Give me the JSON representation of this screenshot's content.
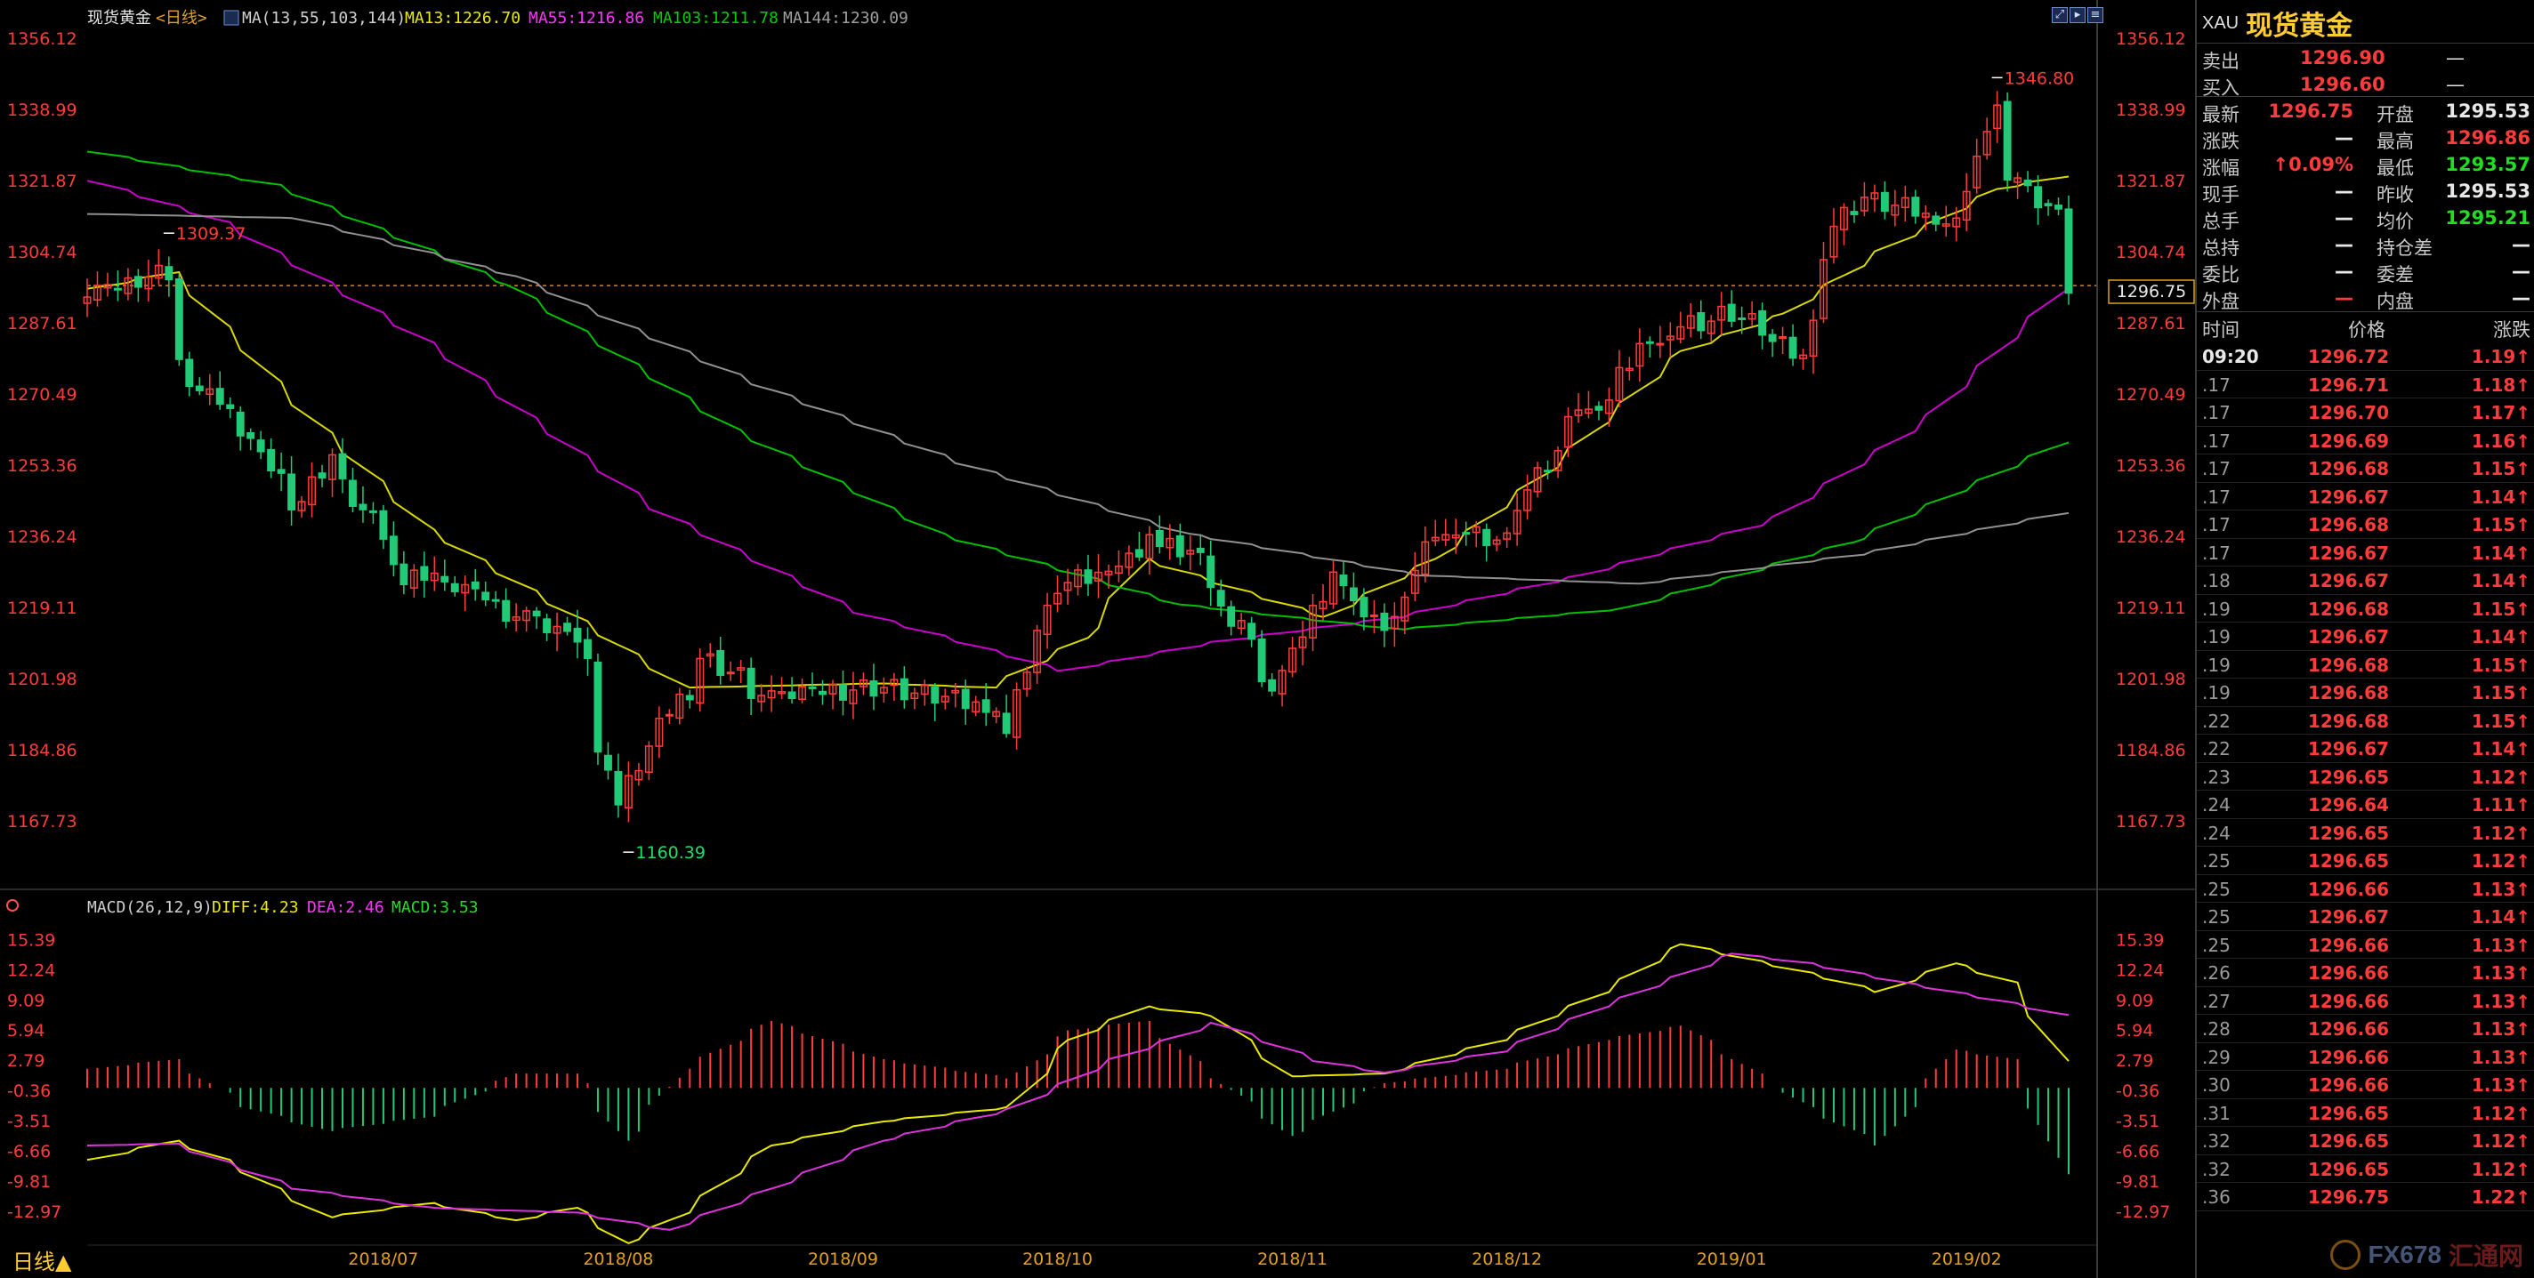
{
  "header": {
    "symbol_name": "现货黄金",
    "period": "<日线>",
    "ma_label": "MA(13,55,103,144)",
    "ma13_label": "MA13:1226.70",
    "ma55_label": "MA55:1216.86",
    "ma103_label": "MA103:1211.78",
    "ma144_label": "MA144:1230.09"
  },
  "macd_header": {
    "label": "MACD(26,12,9)",
    "diff_label": "DIFF:4.23",
    "dea_label": "DEA:2.46",
    "macd_label": "MACD:3.53"
  },
  "bottom_bar": {
    "period_label": "日线▲"
  },
  "current_price_tag": "1296.75",
  "colors": {
    "up": "#ff3b3b",
    "down": "#22c977",
    "ma13": "#d8d800",
    "ma55": "#cc00cc",
    "ma103": "#00c000",
    "ma144": "#909090",
    "diff": "#e8e800",
    "dea": "#dd33dd"
  },
  "chart_data": [
    {
      "type": "candlestick",
      "title": "现货黄金<日线>",
      "ylim": [
        1160,
        1358
      ],
      "y_ticks": [
        "1356.12",
        "1338.99",
        "1321.87",
        "1304.74",
        "1287.61",
        "1270.49",
        "1253.36",
        "1236.24",
        "1219.11",
        "1201.98",
        "1184.86",
        "1167.73"
      ],
      "x_ticks": [
        "2018/07",
        "2018/08",
        "2018/09",
        "2018/10",
        "2018/11",
        "2018/12",
        "2019/01",
        "2019/02"
      ],
      "annotations": [
        {
          "text": "1309.37",
          "date": "2018-06-14",
          "value": 1309.37
        },
        {
          "text": "1160.39",
          "date": "2018-08-16",
          "value": 1160.39
        },
        {
          "text": "1346.80",
          "date": "2019-02-20",
          "value": 1346.8
        }
      ],
      "anchors": [
        [
          "2018-06-04",
          1294
        ],
        [
          "2018-06-14",
          1300
        ],
        [
          "2018-06-15",
          1279
        ],
        [
          "2018-06-22",
          1269
        ],
        [
          "2018-07-02",
          1241
        ],
        [
          "2018-07-06",
          1256
        ],
        [
          "2018-07-17",
          1227
        ],
        [
          "2018-07-26",
          1222
        ],
        [
          "2018-08-01",
          1217
        ],
        [
          "2018-08-09",
          1211
        ],
        [
          "2018-08-15",
          1174
        ],
        [
          "2018-08-17",
          1180
        ],
        [
          "2018-08-27",
          1207
        ],
        [
          "2018-09-05",
          1197
        ],
        [
          "2018-09-20",
          1200
        ],
        [
          "2018-10-05",
          1196
        ],
        [
          "2018-10-08",
          1189
        ],
        [
          "2018-10-12",
          1222
        ],
        [
          "2018-10-23",
          1231
        ],
        [
          "2018-10-26",
          1235
        ],
        [
          "2018-11-01",
          1233
        ],
        [
          "2018-11-13",
          1201
        ],
        [
          "2018-11-21",
          1226
        ],
        [
          "2018-11-28",
          1216
        ],
        [
          "2018-12-06",
          1239
        ],
        [
          "2018-12-14",
          1235
        ],
        [
          "2018-12-21",
          1257
        ],
        [
          "2019-01-04",
          1285
        ],
        [
          "2019-01-15",
          1290
        ],
        [
          "2019-01-24",
          1280
        ],
        [
          "2019-01-29",
          1311
        ],
        [
          "2019-02-01",
          1318
        ],
        [
          "2019-02-14",
          1313
        ],
        [
          "2019-02-20",
          1338
        ],
        [
          "2019-02-21",
          1324
        ],
        [
          "2019-02-27",
          1316
        ],
        [
          "2019-02-28",
          1313
        ],
        [
          "2019-03-01",
          1296.75
        ]
      ],
      "ma_lines": {
        "MA13": [
          [
            "2018-06-04",
            1296
          ],
          [
            "2018-06-15",
            1300
          ],
          [
            "2018-07-02",
            1268
          ],
          [
            "2018-07-20",
            1238
          ],
          [
            "2018-08-10",
            1216
          ],
          [
            "2018-08-24",
            1200
          ],
          [
            "2018-09-20",
            1201
          ],
          [
            "2018-10-05",
            1200
          ],
          [
            "2018-10-18",
            1212
          ],
          [
            "2018-10-26",
            1231
          ],
          [
            "2018-11-09",
            1223
          ],
          [
            "2018-11-20",
            1217
          ],
          [
            "2018-12-05",
            1231
          ],
          [
            "2018-12-21",
            1253
          ],
          [
            "2019-01-08",
            1281
          ],
          [
            "2019-01-22",
            1290
          ],
          [
            "2019-02-04",
            1305
          ],
          [
            "2019-02-20",
            1320
          ],
          [
            "2019-03-01",
            1323
          ]
        ],
        "MA55": [
          [
            "2018-06-04",
            1322
          ],
          [
            "2018-06-22",
            1312
          ],
          [
            "2018-07-20",
            1283
          ],
          [
            "2018-08-20",
            1243
          ],
          [
            "2018-09-17",
            1218
          ],
          [
            "2018-10-15",
            1204
          ],
          [
            "2018-11-05",
            1211
          ],
          [
            "2018-11-30",
            1217
          ],
          [
            "2018-12-25",
            1227
          ],
          [
            "2019-01-20",
            1240
          ],
          [
            "2019-02-10",
            1264
          ],
          [
            "2019-03-01",
            1296
          ]
        ],
        "MA103": [
          [
            "2018-06-04",
            1329
          ],
          [
            "2018-06-29",
            1321
          ],
          [
            "2018-07-31",
            1297
          ],
          [
            "2018-08-31",
            1262
          ],
          [
            "2018-09-28",
            1237
          ],
          [
            "2018-10-31",
            1220
          ],
          [
            "2018-11-30",
            1214
          ],
          [
            "2018-12-31",
            1219
          ],
          [
            "2019-01-31",
            1235
          ],
          [
            "2019-03-01",
            1259
          ]
        ],
        "MA144": [
          [
            "2018-06-04",
            1314
          ],
          [
            "2018-07-02",
            1313
          ],
          [
            "2018-08-01",
            1299
          ],
          [
            "2018-09-03",
            1273
          ],
          [
            "2018-10-01",
            1254
          ],
          [
            "2018-11-01",
            1237
          ],
          [
            "2018-12-03",
            1227
          ],
          [
            "2019-01-02",
            1225
          ],
          [
            "2019-02-01",
            1232
          ],
          [
            "2019-03-01",
            1242
          ]
        ]
      }
    },
    {
      "type": "macd",
      "title": "MACD(26,12,9)",
      "ylim": [
        -15,
        17
      ],
      "y_ticks": [
        "15.39",
        "12.24",
        "9.09",
        "5.94",
        "2.79",
        "-0.36",
        "-3.51",
        "-6.66",
        "-9.81",
        "-12.97"
      ],
      "series": [
        {
          "name": "DIFF",
          "points": [
            [
              "2018-06-04",
              -7.5
            ],
            [
              "2018-06-15",
              -5.5
            ],
            [
              "2018-06-22",
              -7.5
            ],
            [
              "2018-07-06",
              -13.5
            ],
            [
              "2018-07-20",
              -12.0
            ],
            [
              "2018-08-01",
              -13.8
            ],
            [
              "2018-08-09",
              -12.5
            ],
            [
              "2018-08-16",
              -16.2
            ],
            [
              "2018-08-24",
              -13.0
            ],
            [
              "2018-09-05",
              -6.0
            ],
            [
              "2018-09-20",
              -3.5
            ],
            [
              "2018-10-08",
              -2.0
            ],
            [
              "2018-10-16",
              5.0
            ],
            [
              "2018-10-26",
              8.5
            ],
            [
              "2018-11-05",
              7.5
            ],
            [
              "2018-11-15",
              1.2
            ],
            [
              "2018-11-28",
              1.5
            ],
            [
              "2018-12-14",
              5.0
            ],
            [
              "2018-12-28",
              10.0
            ],
            [
              "2019-01-08",
              15.0
            ],
            [
              "2019-01-25",
              12.0
            ],
            [
              "2019-02-04",
              10.0
            ],
            [
              "2019-02-14",
              13.0
            ],
            [
              "2019-02-22",
              11.0
            ],
            [
              "2019-03-01",
              2.8
            ]
          ]
        },
        {
          "name": "DEA",
          "points": [
            [
              "2018-06-04",
              -6.0
            ],
            [
              "2018-06-15",
              -5.8
            ],
            [
              "2018-07-02",
              -10.5
            ],
            [
              "2018-07-20",
              -12.5
            ],
            [
              "2018-08-09",
              -13.0
            ],
            [
              "2018-08-22",
              -14.8
            ],
            [
              "2018-09-05",
              -10.5
            ],
            [
              "2018-09-20",
              -5.5
            ],
            [
              "2018-10-08",
              -2.2
            ],
            [
              "2018-10-22",
              3.0
            ],
            [
              "2018-11-05",
              6.8
            ],
            [
              "2018-11-19",
              2.8
            ],
            [
              "2018-11-28",
              1.6
            ],
            [
              "2018-12-14",
              3.8
            ],
            [
              "2018-12-28",
              8.5
            ],
            [
              "2019-01-15",
              14.0
            ],
            [
              "2019-01-25",
              13.0
            ],
            [
              "2019-02-07",
              11.0
            ],
            [
              "2019-02-21",
              9.0
            ],
            [
              "2019-03-01",
              7.6
            ]
          ]
        },
        {
          "name": "MACD",
          "points": [
            [
              "2018-06-04",
              2.0
            ],
            [
              "2018-06-15",
              3.0
            ],
            [
              "2018-06-25",
              -2.0
            ],
            [
              "2018-07-06",
              -4.5
            ],
            [
              "2018-07-20",
              -3.0
            ],
            [
              "2018-08-01",
              1.5
            ],
            [
              "2018-08-09",
              1.5
            ],
            [
              "2018-08-16",
              -5.5
            ],
            [
              "2018-08-24",
              2.0
            ],
            [
              "2018-09-05",
              7.0
            ],
            [
              "2018-09-20",
              3.0
            ],
            [
              "2018-10-08",
              1.0
            ],
            [
              "2018-10-16",
              6.0
            ],
            [
              "2018-10-26",
              7.0
            ],
            [
              "2018-11-05",
              1.0
            ],
            [
              "2018-11-15",
              -5.0
            ],
            [
              "2018-11-28",
              0.5
            ],
            [
              "2018-12-14",
              2.0
            ],
            [
              "2018-12-28",
              5.0
            ],
            [
              "2019-01-08",
              6.5
            ],
            [
              "2019-01-25",
              -2.0
            ],
            [
              "2019-02-04",
              -6.0
            ],
            [
              "2019-02-14",
              4.0
            ],
            [
              "2019-02-22",
              3.0
            ],
            [
              "2019-03-01",
              -9.0
            ]
          ]
        }
      ]
    }
  ],
  "quote_panel": {
    "code": "XAU",
    "name": "现货黄金",
    "sell_label": "卖出",
    "sell_price": "1296.90",
    "sell_vol": "—",
    "buy_label": "买入",
    "buy_price": "1296.60",
    "buy_vol": "—",
    "rows": [
      {
        "l1": "最新",
        "v1": "1296.75",
        "c1": "red",
        "l2": "开盘",
        "v2": "1295.53",
        "c2": "white"
      },
      {
        "l1": "涨跌",
        "v1": "—",
        "c1": "white",
        "l2": "最高",
        "v2": "1296.86",
        "c2": "red"
      },
      {
        "l1": "涨幅",
        "v1": "↑0.09%",
        "c1": "red",
        "l2": "最低",
        "v2": "1293.57",
        "c2": "green"
      },
      {
        "l1": "现手",
        "v1": "—",
        "c1": "white",
        "l2": "昨收",
        "v2": "1295.53",
        "c2": "white"
      },
      {
        "l1": "总手",
        "v1": "—",
        "c1": "white",
        "l2": "均价",
        "v2": "1295.21",
        "c2": "green"
      },
      {
        "l1": "总持",
        "v1": "—",
        "c1": "white",
        "l2": "持仓差",
        "v2": "—",
        "c2": "white"
      },
      {
        "l1": "委比",
        "v1": "—",
        "c1": "white",
        "l2": "委差",
        "v2": "—",
        "c2": "white"
      },
      {
        "l1": "外盘",
        "v1": "—",
        "c1": "red",
        "l2": "内盘",
        "v2": "—",
        "c2": "white"
      }
    ],
    "ticks_header": {
      "time": "时间",
      "price": "价格",
      "change": "涨跌"
    },
    "ticks": [
      {
        "time": "09:20",
        "price": "1296.72",
        "change": "1.19↑"
      },
      {
        "time": ".17",
        "price": "1296.71",
        "change": "1.18↑"
      },
      {
        "time": ".17",
        "price": "1296.70",
        "change": "1.17↑"
      },
      {
        "time": ".17",
        "price": "1296.69",
        "change": "1.16↑"
      },
      {
        "time": ".17",
        "price": "1296.68",
        "change": "1.15↑"
      },
      {
        "time": ".17",
        "price": "1296.67",
        "change": "1.14↑"
      },
      {
        "time": ".17",
        "price": "1296.68",
        "change": "1.15↑"
      },
      {
        "time": ".17",
        "price": "1296.67",
        "change": "1.14↑"
      },
      {
        "time": ".18",
        "price": "1296.67",
        "change": "1.14↑"
      },
      {
        "time": ".19",
        "price": "1296.68",
        "change": "1.15↑"
      },
      {
        "time": ".19",
        "price": "1296.67",
        "change": "1.14↑"
      },
      {
        "time": ".19",
        "price": "1296.68",
        "change": "1.15↑"
      },
      {
        "time": ".19",
        "price": "1296.68",
        "change": "1.15↑"
      },
      {
        "time": ".22",
        "price": "1296.68",
        "change": "1.15↑"
      },
      {
        "time": ".22",
        "price": "1296.67",
        "change": "1.14↑"
      },
      {
        "time": ".23",
        "price": "1296.65",
        "change": "1.12↑"
      },
      {
        "time": ".24",
        "price": "1296.64",
        "change": "1.11↑"
      },
      {
        "time": ".24",
        "price": "1296.65",
        "change": "1.12↑"
      },
      {
        "time": ".25",
        "price": "1296.65",
        "change": "1.12↑"
      },
      {
        "time": ".25",
        "price": "1296.66",
        "change": "1.13↑"
      },
      {
        "time": ".25",
        "price": "1296.67",
        "change": "1.14↑"
      },
      {
        "time": ".25",
        "price": "1296.66",
        "change": "1.13↑"
      },
      {
        "time": ".26",
        "price": "1296.66",
        "change": "1.13↑"
      },
      {
        "time": ".27",
        "price": "1296.66",
        "change": "1.13↑"
      },
      {
        "time": ".28",
        "price": "1296.66",
        "change": "1.13↑"
      },
      {
        "time": ".29",
        "price": "1296.66",
        "change": "1.13↑"
      },
      {
        "time": ".30",
        "price": "1296.66",
        "change": "1.13↑"
      },
      {
        "time": ".31",
        "price": "1296.65",
        "change": "1.12↑"
      },
      {
        "time": ".32",
        "price": "1296.65",
        "change": "1.12↑"
      },
      {
        "time": ".32",
        "price": "1296.65",
        "change": "1.12↑"
      },
      {
        "time": ".36",
        "price": "1296.75",
        "change": "1.22↑"
      }
    ]
  },
  "watermark": {
    "text": "FX678",
    "cn": "汇通网"
  }
}
